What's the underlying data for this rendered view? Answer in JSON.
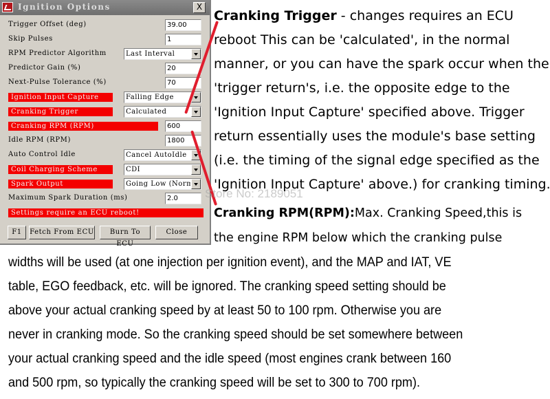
{
  "dialog": {
    "title": "Ignition Options",
    "close_label": "X",
    "fields": [
      {
        "label": "Trigger Offset (deg)",
        "type": "text",
        "value": "39.00",
        "highlight": false
      },
      {
        "label": "Skip Pulses",
        "type": "text",
        "value": "1",
        "highlight": false
      },
      {
        "label": "RPM Predictor Algorithm",
        "type": "select",
        "value": "Last Interval",
        "highlight": false
      },
      {
        "label": "Predictor Gain (%)",
        "type": "text",
        "value": "20",
        "highlight": false
      },
      {
        "label": "Next-Pulse Tolerance (%)",
        "type": "text",
        "value": "70",
        "highlight": false
      },
      {
        "label": "Ignition Input Capture",
        "type": "select",
        "value": "Falling Edge",
        "highlight": true
      },
      {
        "label": "Cranking Trigger",
        "type": "select",
        "value": "Calculated",
        "highlight": true
      },
      {
        "label": "Cranking RPM (RPM)",
        "type": "text",
        "value": "600",
        "highlight": true
      },
      {
        "label": "Idle RPM (RPM)",
        "type": "text",
        "value": "1800",
        "highlight": false
      },
      {
        "label": "Auto Control Idle",
        "type": "select",
        "value": "Cancel AutoIdle",
        "highlight": false
      },
      {
        "label": "Coil Charging Scheme",
        "type": "select",
        "value": "CDI",
        "highlight": true
      },
      {
        "label": "Spark Output",
        "type": "select",
        "value": "Going Low (Normal)",
        "highlight": true
      },
      {
        "label": "Maximum Spark Duration (ms)",
        "type": "text",
        "value": "2.0",
        "highlight": false
      }
    ],
    "warning": "Settings require an ECU reboot!",
    "buttons": {
      "help": "F1",
      "fetch": "Fetch From ECU",
      "burn": "Burn To ECU",
      "close": "Close"
    }
  },
  "annotation": {
    "highlight_color": "#f40000",
    "arrow_color": "#e01e2e",
    "watermark": "Store No: 2189051",
    "para1": {
      "heading": "Cranking Trigger",
      "lines": [
        " - changes requires an ECU",
        "reboot This can be 'calculated', in the normal",
        "manner, or you can have the spark occur when the",
        "'trigger return's, i.e. the opposite edge to the",
        "'Ignition Input Capture' specified above. Trigger",
        "return essentially uses the module's base setting",
        "(i.e. the timing of the signal edge specified as the",
        "'Ignition Input Capture' above.) for cranking timing."
      ]
    },
    "para2": {
      "heading": "Cranking RPM(RPM):",
      "lines": [
        "Max. Cranking Speed,this is",
        "the engine RPM below which the cranking pulse"
      ]
    },
    "para3": {
      "lines": [
        "widths will be used (at one injection per ignition event), and the MAP and IAT, VE",
        "table, EGO feedback, etc. will be ignored. The cranking speed setting should be",
        "above your actual cranking speed by at least 50 to 100 rpm. Otherwise you are",
        "never in cranking mode. So the cranking speed should be set somewhere between",
        "your actual cranking speed and the idle speed (most engines crank between 160",
        "and 500 rpm, so typically the cranking speed will be set to 300 to 700 rpm)."
      ]
    }
  }
}
